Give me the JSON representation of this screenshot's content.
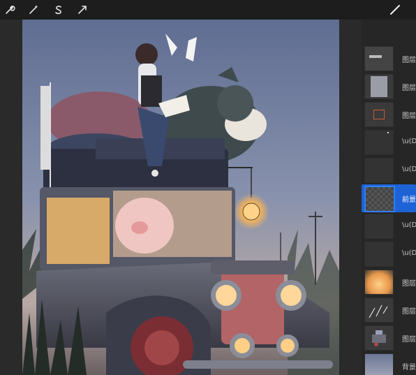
{
  "toolbar": {
    "icons": [
      "wrench-icon",
      "magic-wand-icon",
      "selection-s-icon",
      "transform-arrow-icon",
      "brush-icon"
    ]
  },
  "layers": {
    "items": [
      {
        "label": "图层",
        "thumb": "label-strip",
        "active": false
      },
      {
        "label": "图层",
        "thumb": "gray-page",
        "active": false
      },
      {
        "label": "图层",
        "thumb": "red-sketch",
        "active": false
      },
      {
        "label": "\\u(D",
        "thumb": "dark-dot",
        "active": false
      },
      {
        "label": "\\u(D",
        "thumb": "dark",
        "active": false
      },
      {
        "label": "前景",
        "thumb": "checker",
        "active": true
      },
      {
        "label": "\\u(D",
        "thumb": "dark",
        "active": false
      },
      {
        "label": "\\u(D",
        "thumb": "dark",
        "active": false
      },
      {
        "label": "图层",
        "thumb": "orange-glow",
        "active": false
      },
      {
        "label": "图层",
        "thumb": "white-strokes",
        "active": false
      },
      {
        "label": "图层",
        "thumb": "car-mini",
        "active": false
      },
      {
        "label": "背景",
        "thumb": "sky",
        "active": false
      }
    ]
  },
  "colors": {
    "accent": "#1e63d6",
    "toolbar_bg": "#1d1d1d",
    "panel_bg": "#262626"
  }
}
